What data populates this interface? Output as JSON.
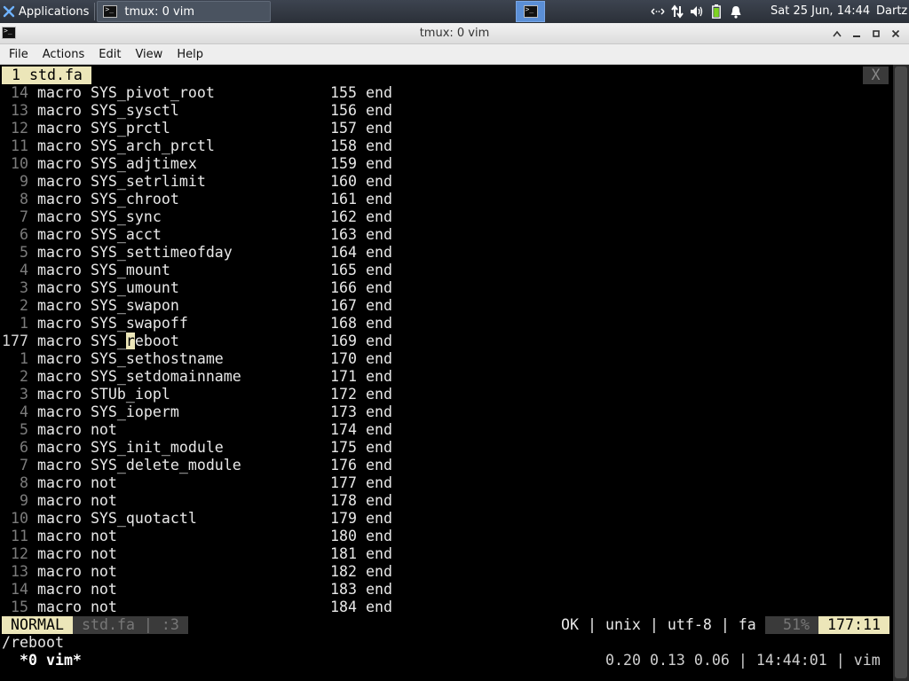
{
  "panel": {
    "apps_label": "Applications",
    "task_title": "tmux: 0 vim",
    "clock": "Sat 25 Jun, 14:44",
    "user": "Dartz",
    "tray_icons": [
      "network-arrows-icon",
      "transfer-icon",
      "volume-icon",
      "battery-icon",
      "bell-icon"
    ]
  },
  "window": {
    "title": "tmux: 0 vim"
  },
  "menu": [
    "File",
    "Actions",
    "Edit",
    "View",
    "Help"
  ],
  "vim": {
    "tab_label": "1 std.fa",
    "tab_close": "X",
    "lines": [
      {
        "num": "14",
        "text": "macro SYS_pivot_root",
        "col2": "155 end"
      },
      {
        "num": "13",
        "text": "macro SYS_sysctl",
        "col2": "156 end"
      },
      {
        "num": "12",
        "text": "macro SYS_prctl",
        "col2": "157 end"
      },
      {
        "num": "11",
        "text": "macro SYS_arch_prctl",
        "col2": "158 end"
      },
      {
        "num": "10",
        "text": "macro SYS_adjtimex",
        "col2": "159 end"
      },
      {
        "num": "9",
        "text": "macro SYS_setrlimit",
        "col2": "160 end"
      },
      {
        "num": "8",
        "text": "macro SYS_chroot",
        "col2": "161 end"
      },
      {
        "num": "7",
        "text": "macro SYS_sync",
        "col2": "162 end"
      },
      {
        "num": "6",
        "text": "macro SYS_acct",
        "col2": "163 end"
      },
      {
        "num": "5",
        "text": "macro SYS_settimeofday",
        "col2": "164 end"
      },
      {
        "num": "4",
        "text": "macro SYS_mount",
        "col2": "165 end"
      },
      {
        "num": "3",
        "text": "macro SYS_umount",
        "col2": "166 end"
      },
      {
        "num": "2",
        "text": "macro SYS_swapon",
        "col2": "167 end"
      },
      {
        "num": "1",
        "text": "macro SYS_swapoff",
        "col2": "168 end"
      },
      {
        "num": "177",
        "text": "macro SYS_reboot",
        "col2": "169 end",
        "current": true
      },
      {
        "num": "1",
        "text": "macro SYS_sethostname",
        "col2": "170 end"
      },
      {
        "num": "2",
        "text": "macro SYS_setdomainname",
        "col2": "171 end"
      },
      {
        "num": "3",
        "text": "macro STUb_iopl",
        "col2": "172 end"
      },
      {
        "num": "4",
        "text": "macro SYS_ioperm",
        "col2": "173 end"
      },
      {
        "num": "5",
        "text": "macro not",
        "col2": "174 end"
      },
      {
        "num": "6",
        "text": "macro SYS_init_module",
        "col2": "175 end"
      },
      {
        "num": "7",
        "text": "macro SYS_delete_module",
        "col2": "176 end"
      },
      {
        "num": "8",
        "text": "macro not",
        "col2": "177 end"
      },
      {
        "num": "9",
        "text": "macro not",
        "col2": "178 end"
      },
      {
        "num": "10",
        "text": "macro SYS_quotactl",
        "col2": "179 end"
      },
      {
        "num": "11",
        "text": "macro not",
        "col2": "180 end"
      },
      {
        "num": "12",
        "text": "macro not",
        "col2": "181 end"
      },
      {
        "num": "13",
        "text": "macro not",
        "col2": "182 end"
      },
      {
        "num": "14",
        "text": "macro not",
        "col2": "183 end"
      },
      {
        "num": "15",
        "text": "macro not",
        "col2": "184 end"
      }
    ],
    "cursor_before": "macro SYS_",
    "cursor_char": "r",
    "cursor_after": "eboot",
    "status": {
      "mode": "NORMAL",
      "file": "std.fa | :3",
      "info": "OK | unix | utf-8 | fa",
      "percent": "51%",
      "position": "177:11"
    },
    "cmdline": "/reboot"
  },
  "tmux": {
    "window": " *0 vim*",
    "right": "0.20 0.13 0.06 | 14:44:01 | vim"
  },
  "colors": {
    "accent_yellow": "#ece6b9",
    "status_gray": "#3a3a3a",
    "workspace_blue": "#5b8fd6"
  }
}
